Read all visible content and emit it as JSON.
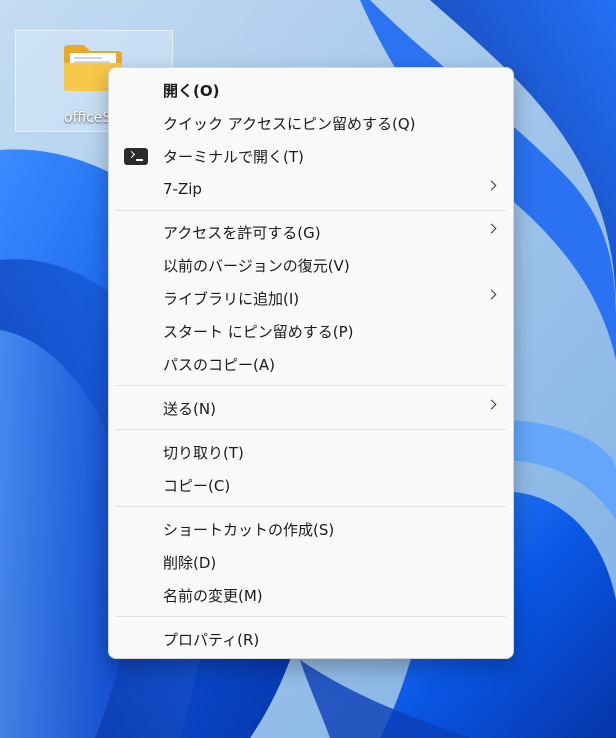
{
  "desktop": {
    "folder_label": "officeS"
  },
  "context_menu": {
    "open": {
      "label": "開く(O)"
    },
    "pin_quick_access": {
      "label": "クイック アクセスにピン留めする(Q)"
    },
    "open_terminal": {
      "label": "ターミナルで開く(T)",
      "icon": "terminal-icon"
    },
    "seven_zip": {
      "label": "7-Zip",
      "has_submenu": true
    },
    "give_access": {
      "label": "アクセスを許可する(G)",
      "has_submenu": true
    },
    "restore_previous": {
      "label": "以前のバージョンの復元(V)"
    },
    "include_library": {
      "label": "ライブラリに追加(I)",
      "has_submenu": true
    },
    "pin_start": {
      "label": "スタート にピン留めする(P)"
    },
    "copy_path": {
      "label": "パスのコピー(A)"
    },
    "send_to": {
      "label": "送る(N)",
      "has_submenu": true
    },
    "cut": {
      "label": "切り取り(T)"
    },
    "copy": {
      "label": "コピー(C)"
    },
    "create_shortcut": {
      "label": "ショートカットの作成(S)"
    },
    "delete": {
      "label": "削除(D)"
    },
    "rename": {
      "label": "名前の変更(M)"
    },
    "properties": {
      "label": "プロパティ(R)"
    }
  },
  "colors": {
    "menu_background": "#f9f9f9",
    "wallpaper_blue": "#0a57e6",
    "wallpaper_sky": "#9ec3e6"
  }
}
